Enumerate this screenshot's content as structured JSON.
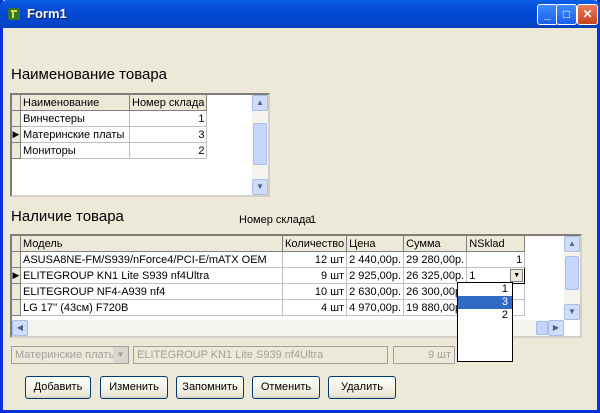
{
  "window": {
    "title": "Form1"
  },
  "top_section": {
    "heading": "Наименование товара",
    "columns": [
      "Наименование",
      "Номер склада"
    ],
    "rows": [
      {
        "name": "Винчестеры",
        "warehouse": "1",
        "current": false
      },
      {
        "name": "Материнские платы",
        "warehouse": "3",
        "current": true
      },
      {
        "name": "Мониторы",
        "warehouse": "2",
        "current": false
      }
    ]
  },
  "bottom_section": {
    "heading": "Наличие товара",
    "warehouse_label": "Номер склада",
    "warehouse_value": "1",
    "columns": [
      "Модель",
      "Количество",
      "Цена",
      "Сумма",
      "NSklad"
    ],
    "rows": [
      {
        "model": "ASUSA8NE-FM/S939/nForce4/PCI-E/mATX OEM",
        "qty": "12 шт",
        "price": "2 440,00р.",
        "sum": "29 280,00р.",
        "nsklad": "1",
        "current": false
      },
      {
        "model": "ELITEGROUP KN1 Lite S939 nf4Ultra",
        "qty": "9 шт",
        "price": "2 925,00р.",
        "sum": "26 325,00р.",
        "nsklad": "1",
        "current": true
      },
      {
        "model": "ELITEGROUP NF4-A939 nf4",
        "qty": "10 шт",
        "price": "2 630,00р.",
        "sum": "26 300,00р.",
        "nsklad": "",
        "current": false
      },
      {
        "model": "LG 17'' (43см) F720B",
        "qty": "4 шт",
        "price": "4 970,00р.",
        "sum": "19 880,00р.",
        "nsklad": "",
        "current": false
      }
    ],
    "dropdown_options": [
      "1",
      "3",
      "2"
    ],
    "dropdown_selected": "3"
  },
  "edit_row": {
    "category": "Материнские платы",
    "model": "ELITEGROUP KN1 Lite S939 nf4Ultra",
    "qty": "9 шт"
  },
  "buttons": {
    "add": "Добавить",
    "edit": "Изменить",
    "save": "Запомнить",
    "cancel": "Отменить",
    "delete": "Удалить"
  }
}
